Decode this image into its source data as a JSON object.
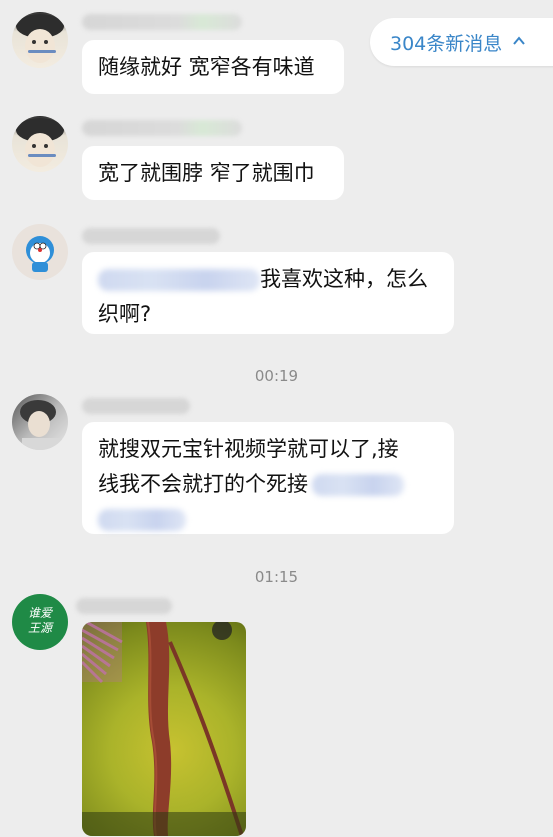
{
  "new_messages": {
    "label": "304条新消息",
    "icon": "chevron-up-icon"
  },
  "messages": [
    {
      "text": "随缘就好 宽窄各有味道"
    },
    {
      "text": "宽了就围脖 窄了就围巾"
    },
    {
      "line1": "我喜欢这种，怎么",
      "line2": "织啊?"
    },
    {
      "line1": "就搜双元宝针视频学就可以了,接",
      "line2": "线我不会就打的个死接"
    }
  ],
  "times": [
    "00:19",
    "01:15"
  ],
  "avatars": [
    {
      "text_line1": "谁爱",
      "text_line2": "王源"
    }
  ],
  "colors": {
    "background": "#ededed",
    "bubble": "#ffffff",
    "accent": "#3a86c8"
  }
}
